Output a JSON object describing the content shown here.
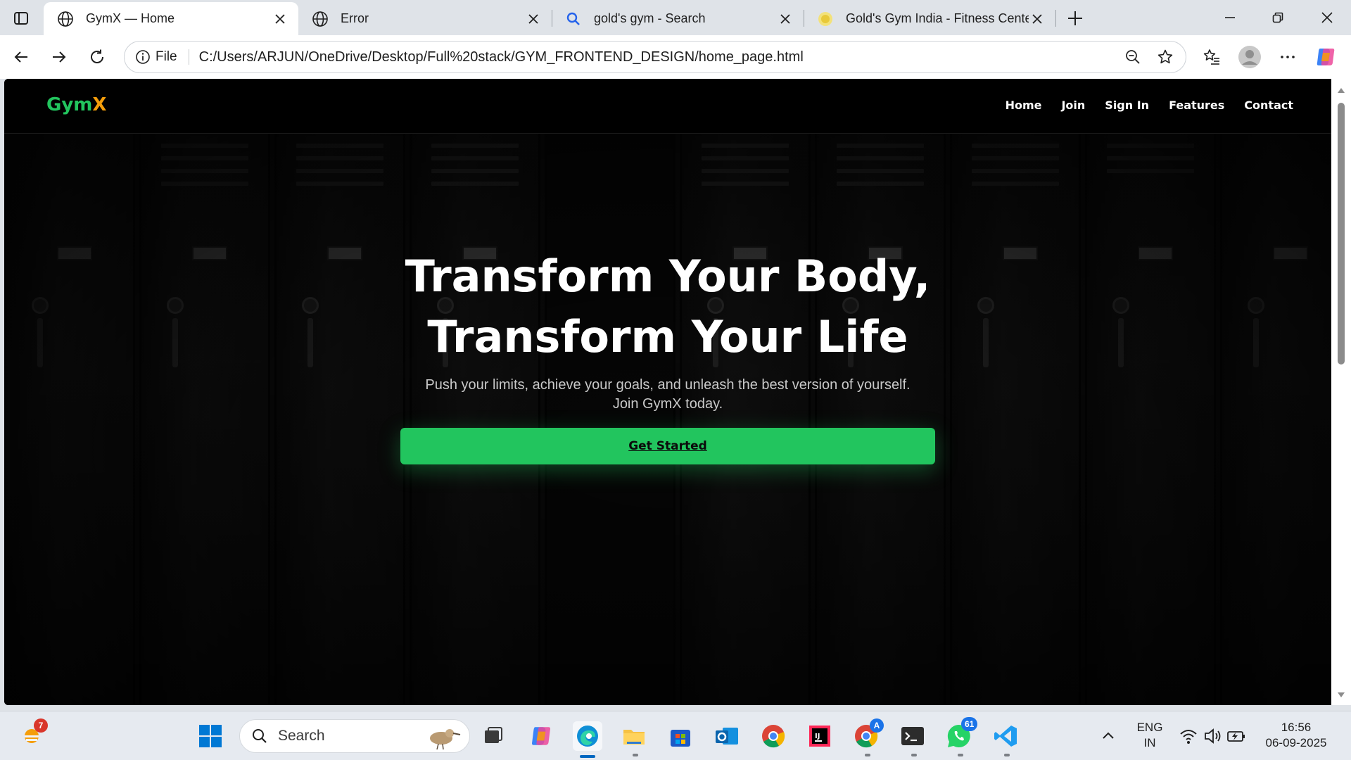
{
  "browser": {
    "tabs": [
      {
        "title": "GymX — Home",
        "icon": "globe-icon",
        "active": true
      },
      {
        "title": "Error",
        "icon": "globe-icon",
        "active": false
      },
      {
        "title": "gold's gym - Search",
        "icon": "search-icon",
        "active": false
      },
      {
        "title": "Gold's Gym India - Fitness Center",
        "icon": "site-favicon-icon",
        "active": false
      }
    ],
    "address": {
      "scheme_label": "File",
      "url": "C:/Users/ARJUN/OneDrive/Desktop/Full%20stack/GYM_FRONTEND_DESIGN/home_page.html"
    }
  },
  "site": {
    "logo": {
      "part1": "Gym",
      "part2": "X",
      "color1": "#22c55e",
      "color2": "#f59e0b"
    },
    "nav": [
      {
        "label": "Home"
      },
      {
        "label": "Join"
      },
      {
        "label": "Sign In"
      },
      {
        "label": "Features"
      },
      {
        "label": "Contact"
      }
    ],
    "hero": {
      "title_line1": "Transform Your Body,",
      "title_line2": "Transform Your Life",
      "subtitle": "Push your limits, achieve your goals, and unleash the best version of yourself. Join GymX today.",
      "cta_label": "Get Started",
      "accent": "#22c55e"
    }
  },
  "taskbar": {
    "weather_badge": "7",
    "search_label": "Search",
    "chrome_profile_badge": "A",
    "whatsapp_badge": "61",
    "language_line1": "ENG",
    "language_line2": "IN",
    "time": "16:56",
    "date": "06-09-2025"
  }
}
